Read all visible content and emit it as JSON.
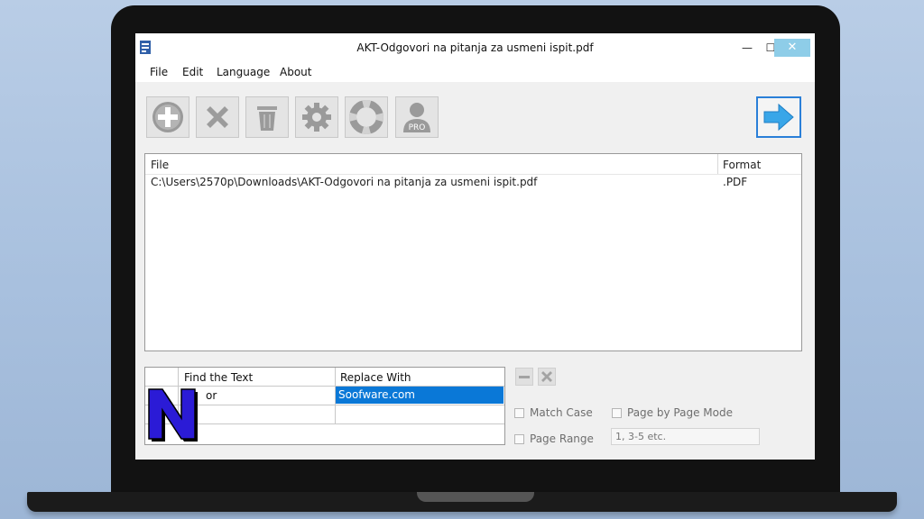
{
  "window": {
    "title": "AKT-Odgovori na pitanja za usmeni ispit.pdf",
    "controls": {
      "minimize": "—",
      "maximize": "☐",
      "close": "✕"
    }
  },
  "menu": [
    "File",
    "Edit",
    "Language",
    "About"
  ],
  "toolbar": {
    "buttons": [
      "add-icon",
      "remove-icon",
      "trash-icon",
      "settings-icon",
      "help-lifebuoy-icon",
      "pro-user-icon"
    ],
    "pro_badge": "PRO",
    "convert": "arrow-right-icon"
  },
  "file_list": {
    "headers": {
      "file": "File",
      "format": "Format"
    },
    "rows": [
      {
        "file": "C:\\Users\\2570p\\Downloads\\AKT-Odgovori na pitanja za usmeni ispit.pdf",
        "format": ".PDF"
      }
    ]
  },
  "replace_table": {
    "headers": {
      "find": "Find the Text",
      "replace": "Replace With"
    },
    "rows": [
      {
        "find": "or",
        "replace": "Soofware.com"
      }
    ]
  },
  "options": {
    "match_case": "Match Case",
    "page_by_page": "Page by Page Mode",
    "page_range": "Page Range",
    "page_range_placeholder": "1, 3-5 etc."
  },
  "colors": {
    "accent": "#0a78d7",
    "close_button": "#8ecde8",
    "convert_arrow": "#39a6e8",
    "watermark": "#2b1bd6"
  }
}
